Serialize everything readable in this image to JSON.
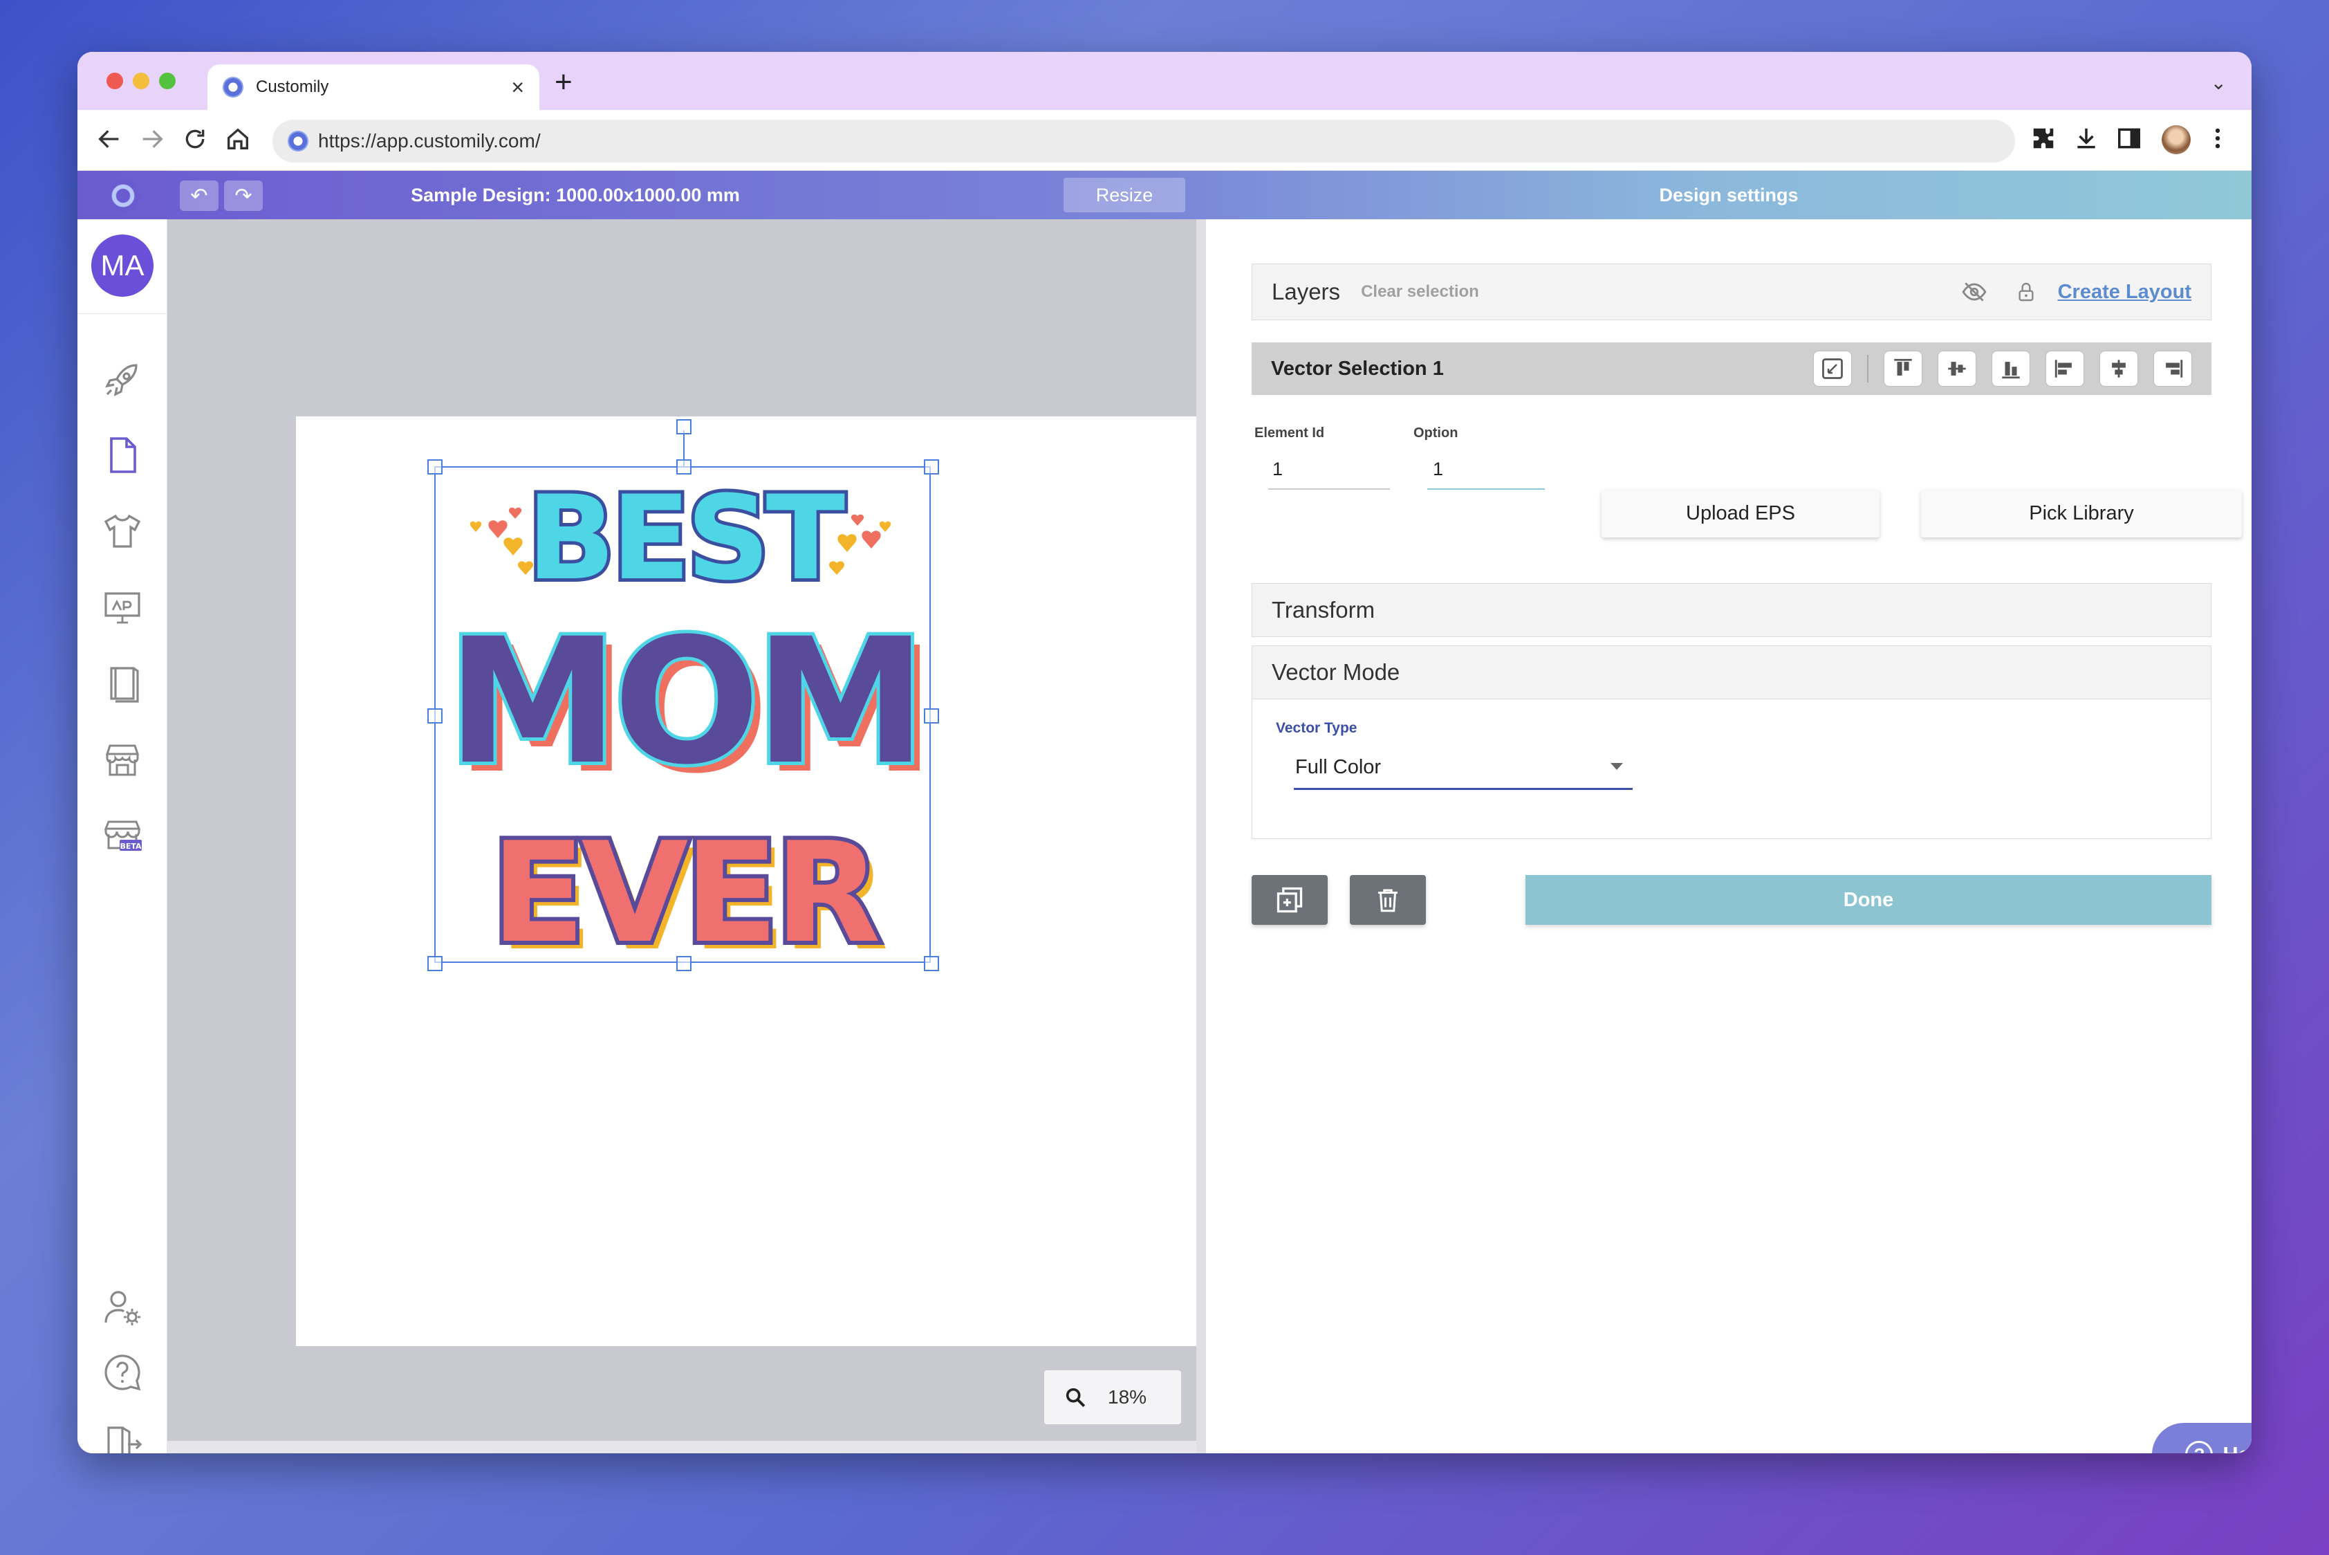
{
  "browser": {
    "tab_title": "Customily",
    "tab_close": "×",
    "new_tab": "+",
    "tab_menu": "⌄",
    "url": "https://app.customily.com/"
  },
  "header": {
    "undo": "↶",
    "redo": "↷",
    "design_title": "Sample Design: 1000.00x1000.00 mm",
    "resize_label": "Resize",
    "settings_title": "Design settings"
  },
  "sidebar": {
    "avatar_initials": "MA",
    "items": [
      {
        "icon": "rocket-icon"
      },
      {
        "icon": "file-icon"
      },
      {
        "icon": "tshirt-icon"
      },
      {
        "icon": "monitor-icon"
      },
      {
        "icon": "book-icon"
      },
      {
        "icon": "store-icon"
      },
      {
        "icon": "store-beta-icon"
      },
      {
        "icon": "user-settings-icon"
      },
      {
        "icon": "help-bubble-icon"
      },
      {
        "icon": "logout-icon"
      }
    ],
    "beta_label": "BETA"
  },
  "canvas": {
    "zoom": "18%",
    "art": {
      "line1": "BEST",
      "line2": "MOM",
      "line3": "EVER"
    }
  },
  "panel": {
    "layers_title": "Layers",
    "clear_selection": "Clear selection",
    "create_layout": "Create Layout",
    "selection_title": "Vector Selection 1",
    "element_id_label": "Element Id",
    "element_id_value": "1",
    "option_label": "Option",
    "option_value": "1",
    "upload_eps": "Upload EPS",
    "pick_library": "Pick Library",
    "transform_title": "Transform",
    "vector_mode_title": "Vector Mode",
    "vector_type_label": "Vector Type",
    "vector_type_value": "Full Color",
    "done_label": "Done",
    "help_label": "Help",
    "help_symbol": "?"
  },
  "colors": {
    "accent": "#6b5bd0",
    "done": "#8dc4d2",
    "help": "#7b7fd8",
    "selection": "#4a7fe0"
  }
}
